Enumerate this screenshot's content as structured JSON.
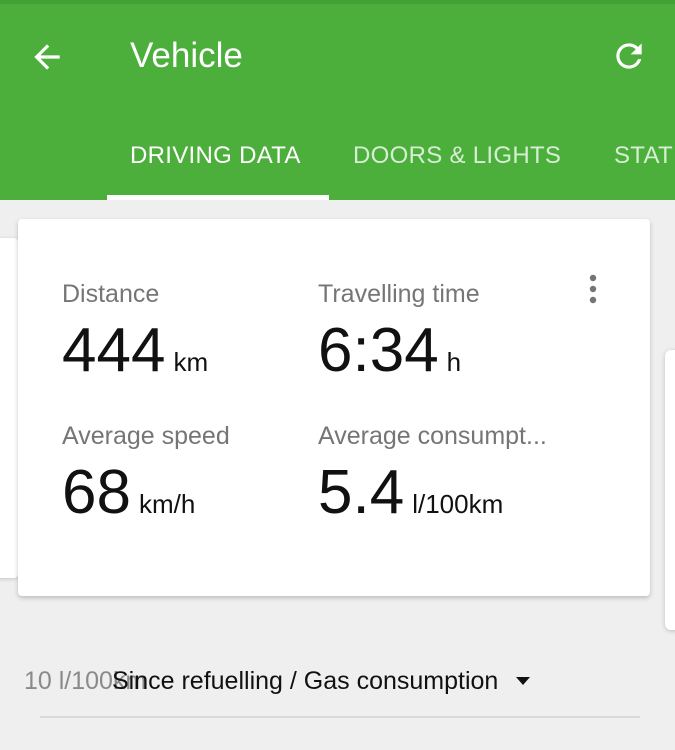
{
  "header": {
    "title": "Vehicle",
    "back_icon": "arrow-back-icon",
    "refresh_icon": "refresh-icon",
    "color": "#4caf3c"
  },
  "tabs": [
    {
      "label": "DRIVING DATA",
      "active": true
    },
    {
      "label": "DOORS & LIGHTS",
      "active": false
    },
    {
      "label": "STAT",
      "active": false
    }
  ],
  "driving_card": {
    "distance": {
      "label": "Distance",
      "value": "444",
      "unit": "km"
    },
    "travel_time": {
      "label": "Travelling time",
      "value": "6:34",
      "unit": "h"
    },
    "avg_speed": {
      "label": "Average speed",
      "value": "68",
      "unit": "km/h"
    },
    "avg_consumption": {
      "label": "Average consumpt...",
      "value": "5.4",
      "unit": "l/100km"
    },
    "menu_icon": "more-vert-icon"
  },
  "chart": {
    "axis_label": "10 l/100km",
    "selector_label": "Since refuelling / Gas consumption",
    "selector_icon": "dropdown-arrow-icon"
  }
}
